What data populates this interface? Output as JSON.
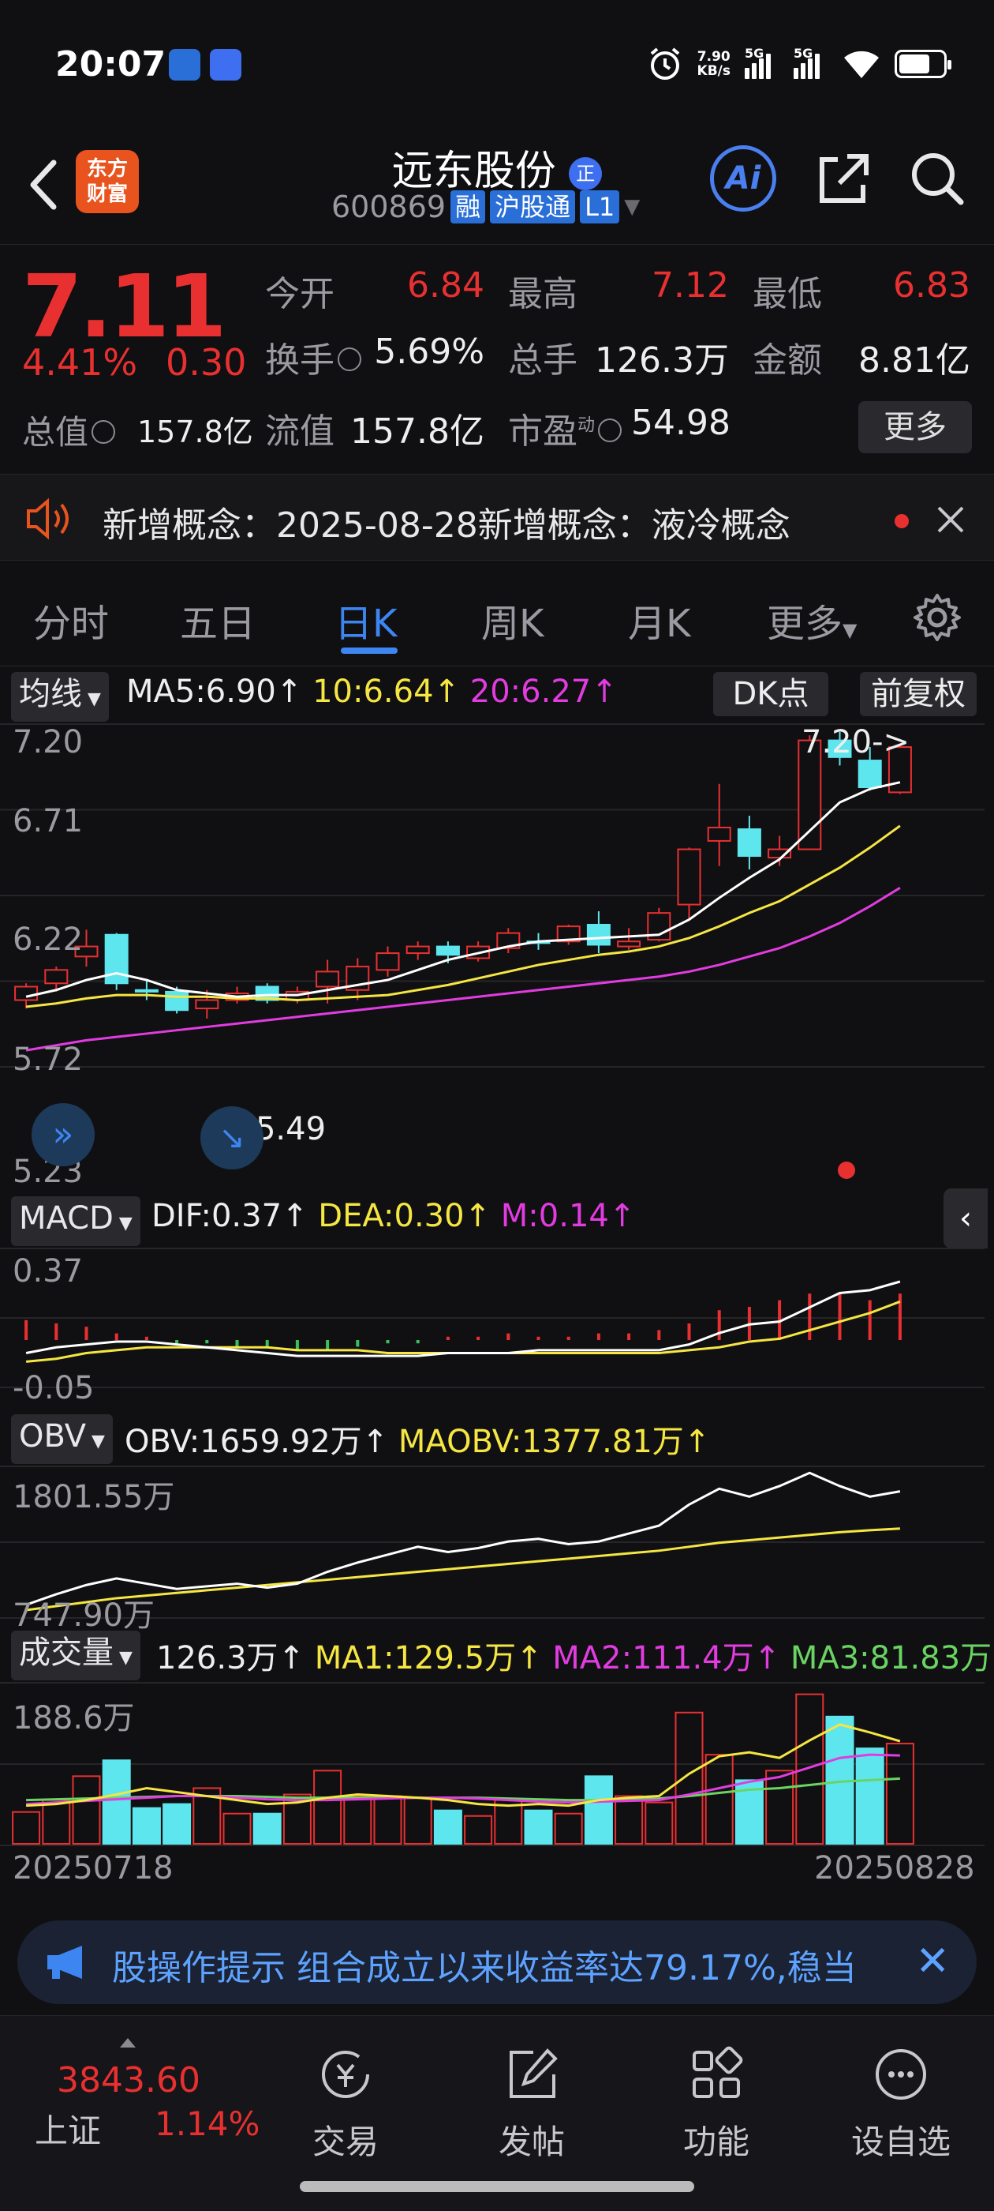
{
  "status_bar": {
    "time": "20:07",
    "net_speed_top": "7.90",
    "net_speed_unit": "KB/s",
    "sim1": "5G",
    "sim2": "5G"
  },
  "header": {
    "brand_line1": "东方",
    "brand_line2": "财富",
    "stock_name": "远东股份",
    "name_badge": "正",
    "stock_code": "600869",
    "tags": [
      "融",
      "沪股通",
      "L1"
    ],
    "ai_label": "Ai"
  },
  "quote": {
    "price": "7.11",
    "change_pct": "4.41%",
    "change_amt": "0.30",
    "open_label": "今开",
    "open_val": "6.84",
    "high_label": "最高",
    "high_val": "7.12",
    "low_label": "最低",
    "low_val": "6.83",
    "turnover_label": "换手",
    "turnover_val": "5.69%",
    "volume_label": "总手",
    "volume_val": "126.3万",
    "amount_label": "金额",
    "amount_val": "8.81亿",
    "mktcap_label": "总值",
    "mktcap_val": "157.8亿",
    "float_label": "流值",
    "float_val": "157.8亿",
    "pe_label": "市盈",
    "pe_sup": "动",
    "pe_val": "54.98",
    "more_label": "更多"
  },
  "notice": {
    "text": "新增概念：2025-08-28新增概念：液冷概念"
  },
  "tabs": [
    "分时",
    "五日",
    "日K",
    "周K",
    "月K",
    "更多"
  ],
  "active_tab": 2,
  "kline_panel": {
    "selector": "均线",
    "ma5": "MA5:6.90",
    "ma10": "10:6.64",
    "ma20": "20:6.27",
    "arrow": "↑",
    "dk_label": "DK点",
    "adjust_label": "前复权",
    "y_labels": [
      "7.20",
      "6.71",
      "6.22",
      "5.72",
      "5.23"
    ],
    "high_marker": "7.20->",
    "low_marker": "<-5.49"
  },
  "macd_panel": {
    "selector": "MACD",
    "dif": "DIF:0.37",
    "dea": "DEA:0.30",
    "m": "M:0.14",
    "y_top": "0.37",
    "y_bottom": "-0.05"
  },
  "obv_panel": {
    "selector": "OBV",
    "obv": "OBV:1659.92万",
    "maobv": "MAOBV:1377.81万",
    "y_top": "1801.55万",
    "y_bottom": "747.90万"
  },
  "vol_panel": {
    "selector": "成交量",
    "vol": "126.3万",
    "ma1": "MA1:129.5万",
    "ma2": "MA2:111.4万",
    "ma3": "MA3:81.83万",
    "y_top": "188.6万",
    "date_start": "20250718",
    "date_end": "20250828"
  },
  "ad_bar": {
    "text": "股操作提示 组合成立以来收益率达79.17%,稳当"
  },
  "bottom_bar": {
    "index_value": "3843.60",
    "index_name": "上证",
    "index_pct": "1.14%",
    "nav": [
      "交易",
      "发帖",
      "功能",
      "设自选"
    ]
  },
  "colors": {
    "up": "#e93030",
    "down": "#5ee6ee",
    "ma5": "#ffffff",
    "ma10": "#f5e642",
    "ma20": "#e23ce0",
    "accent": "#3d86f2"
  },
  "chart_data": {
    "type": "candlestick",
    "dates_range": [
      "20250718",
      "20250828"
    ],
    "candles": [
      {
        "o": 5.6,
        "c": 5.68,
        "h": 5.7,
        "l": 5.55
      },
      {
        "o": 5.7,
        "c": 5.78,
        "h": 5.8,
        "l": 5.65
      },
      {
        "o": 5.86,
        "c": 5.92,
        "h": 6.02,
        "l": 5.8
      },
      {
        "o": 5.99,
        "c": 5.7,
        "h": 6.0,
        "l": 5.66
      },
      {
        "o": 5.66,
        "c": 5.65,
        "h": 5.72,
        "l": 5.6
      },
      {
        "o": 5.65,
        "c": 5.54,
        "h": 5.68,
        "l": 5.52
      },
      {
        "o": 5.55,
        "c": 5.6,
        "h": 5.66,
        "l": 5.49
      },
      {
        "o": 5.6,
        "c": 5.64,
        "h": 5.68,
        "l": 5.58
      },
      {
        "o": 5.68,
        "c": 5.6,
        "h": 5.7,
        "l": 5.58
      },
      {
        "o": 5.6,
        "c": 5.65,
        "h": 5.68,
        "l": 5.58
      },
      {
        "o": 5.68,
        "c": 5.77,
        "h": 5.84,
        "l": 5.58
      },
      {
        "o": 5.66,
        "c": 5.8,
        "h": 5.85,
        "l": 5.6
      },
      {
        "o": 5.78,
        "c": 5.88,
        "h": 5.92,
        "l": 5.74
      },
      {
        "o": 5.88,
        "c": 5.92,
        "h": 5.95,
        "l": 5.84
      },
      {
        "o": 5.92,
        "c": 5.87,
        "h": 5.95,
        "l": 5.82
      },
      {
        "o": 5.85,
        "c": 5.92,
        "h": 5.95,
        "l": 5.83
      },
      {
        "o": 5.91,
        "c": 6.0,
        "h": 6.03,
        "l": 5.88
      },
      {
        "o": 5.95,
        "c": 5.94,
        "h": 6.0,
        "l": 5.9
      },
      {
        "o": 5.95,
        "c": 6.04,
        "h": 6.05,
        "l": 5.93
      },
      {
        "o": 6.05,
        "c": 5.93,
        "h": 6.13,
        "l": 5.88
      },
      {
        "o": 5.92,
        "c": 5.95,
        "h": 6.03,
        "l": 5.9
      },
      {
        "o": 5.96,
        "c": 6.12,
        "h": 6.15,
        "l": 5.95
      },
      {
        "o": 6.17,
        "c": 6.5,
        "h": 6.51,
        "l": 6.08
      },
      {
        "o": 6.55,
        "c": 6.63,
        "h": 6.89,
        "l": 6.4
      },
      {
        "o": 6.62,
        "c": 6.46,
        "h": 6.7,
        "l": 6.38
      },
      {
        "o": 6.45,
        "c": 6.5,
        "h": 6.58,
        "l": 6.4
      },
      {
        "o": 6.5,
        "c": 7.15,
        "h": 7.18,
        "l": 6.5
      },
      {
        "o": 7.15,
        "c": 7.05,
        "h": 7.2,
        "l": 7.0
      },
      {
        "o": 7.03,
        "c": 6.87,
        "h": 7.11,
        "l": 6.85
      },
      {
        "o": 6.84,
        "c": 7.11,
        "h": 7.12,
        "l": 6.83
      }
    ],
    "ma5": [
      5.62,
      5.66,
      5.72,
      5.76,
      5.72,
      5.66,
      5.64,
      5.62,
      5.63,
      5.63,
      5.66,
      5.69,
      5.72,
      5.78,
      5.84,
      5.88,
      5.92,
      5.95,
      5.96,
      5.97,
      5.98,
      5.99,
      6.08,
      6.21,
      6.33,
      6.44,
      6.61,
      6.78,
      6.86,
      6.9
    ],
    "ma10": [
      5.56,
      5.58,
      5.61,
      5.63,
      5.63,
      5.62,
      5.62,
      5.61,
      5.61,
      5.6,
      5.61,
      5.62,
      5.63,
      5.66,
      5.69,
      5.73,
      5.77,
      5.81,
      5.84,
      5.87,
      5.89,
      5.92,
      5.97,
      6.04,
      6.12,
      6.19,
      6.29,
      6.39,
      6.51,
      6.64
    ],
    "ma20": [
      5.3,
      5.33,
      5.36,
      5.38,
      5.4,
      5.42,
      5.44,
      5.46,
      5.48,
      5.5,
      5.52,
      5.54,
      5.56,
      5.58,
      5.6,
      5.62,
      5.64,
      5.66,
      5.68,
      5.7,
      5.72,
      5.74,
      5.77,
      5.81,
      5.86,
      5.91,
      5.98,
      6.06,
      6.16,
      6.27
    ],
    "y_range": [
      5.23,
      7.2
    ],
    "macd": {
      "dif": [
        0.12,
        0.14,
        0.15,
        0.16,
        0.16,
        0.15,
        0.14,
        0.13,
        0.12,
        0.11,
        0.11,
        0.11,
        0.11,
        0.11,
        0.12,
        0.12,
        0.12,
        0.13,
        0.13,
        0.13,
        0.13,
        0.13,
        0.15,
        0.19,
        0.22,
        0.23,
        0.28,
        0.33,
        0.34,
        0.37
      ],
      "dea": [
        0.09,
        0.1,
        0.12,
        0.13,
        0.14,
        0.14,
        0.14,
        0.14,
        0.14,
        0.13,
        0.13,
        0.13,
        0.12,
        0.12,
        0.12,
        0.12,
        0.12,
        0.12,
        0.12,
        0.12,
        0.12,
        0.12,
        0.13,
        0.14,
        0.16,
        0.17,
        0.2,
        0.23,
        0.26,
        0.3
      ],
      "m": [
        0.06,
        0.05,
        0.04,
        0.02,
        0.01,
        -0.01,
        -0.01,
        -0.02,
        -0.02,
        -0.03,
        -0.03,
        -0.02,
        -0.01,
        -0.01,
        0.01,
        0.01,
        0.02,
        0.01,
        0.01,
        0.02,
        0.02,
        0.03,
        0.05,
        0.09,
        0.1,
        0.12,
        0.14,
        0.14,
        0.12,
        0.14
      ],
      "y_range": [
        -0.05,
        0.37
      ]
    },
    "obv": {
      "obv": [
        800,
        880,
        950,
        1000,
        960,
        920,
        940,
        960,
        930,
        960,
        1050,
        1120,
        1180,
        1240,
        1200,
        1230,
        1280,
        1300,
        1260,
        1280,
        1340,
        1400,
        1560,
        1680,
        1620,
        1700,
        1800,
        1700,
        1620,
        1660
      ],
      "maobv": [
        760,
        790,
        820,
        850,
        870,
        890,
        910,
        930,
        950,
        970,
        990,
        1010,
        1030,
        1050,
        1070,
        1090,
        1110,
        1130,
        1150,
        1170,
        1190,
        1210,
        1240,
        1270,
        1290,
        1310,
        1330,
        1350,
        1365,
        1378
      ],
      "y_range": [
        747.9,
        1801.55
      ]
    },
    "volume": {
      "values": [
        40,
        55,
        85,
        105,
        45,
        50,
        70,
        38,
        38,
        62,
        92,
        60,
        60,
        58,
        42,
        35,
        55,
        42,
        38,
        85,
        60,
        52,
        165,
        112,
        80,
        92,
        188,
        160,
        120,
        126
      ],
      "ma1": [
        48,
        50,
        55,
        62,
        70,
        65,
        60,
        55,
        50,
        52,
        58,
        62,
        60,
        58,
        55,
        50,
        48,
        50,
        48,
        55,
        58,
        60,
        88,
        110,
        115,
        108,
        130,
        150,
        140,
        129
      ],
      "ma2": [
        50,
        52,
        54,
        56,
        58,
        60,
        60,
        58,
        56,
        55,
        55,
        56,
        57,
        58,
        58,
        57,
        55,
        53,
        52,
        53,
        54,
        55,
        62,
        70,
        78,
        84,
        96,
        108,
        112,
        111
      ],
      "ma3": [
        55,
        56,
        57,
        58,
        59,
        60,
        60,
        60,
        59,
        58,
        58,
        58,
        58,
        58,
        58,
        58,
        57,
        56,
        55,
        55,
        56,
        57,
        60,
        64,
        68,
        70,
        74,
        78,
        80,
        82
      ],
      "y_max": 188.6
    }
  }
}
